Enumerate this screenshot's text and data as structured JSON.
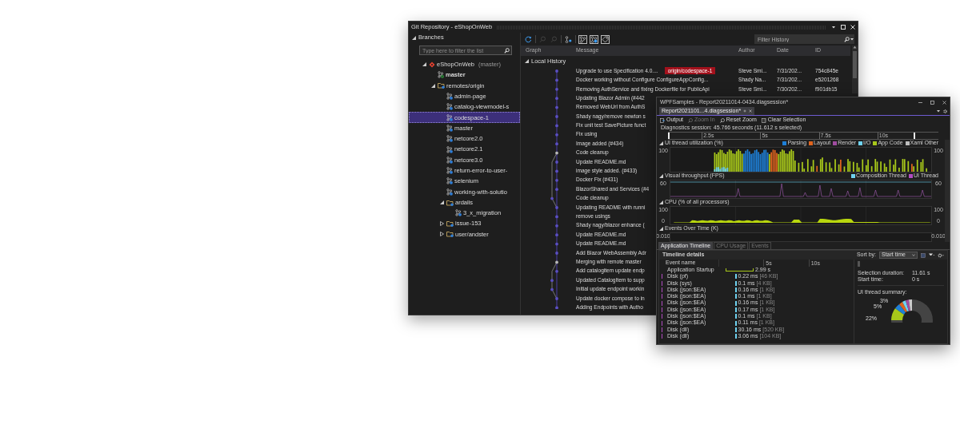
{
  "git_window": {
    "title": "Git Repository - eShopOnWeb",
    "branches": {
      "header": "Branches",
      "expanded": true,
      "filter": {
        "placeholder": "Type here to filter the list"
      },
      "tree": [
        {
          "label": "eShopOnWeb",
          "suffix": "(master)",
          "kind": "repo",
          "expanded": true,
          "selected": false,
          "children": [
            {
              "label": "master",
              "kind": "current_branch",
              "selected": false
            },
            {
              "label": "remotes/origin",
              "kind": "remote_folder",
              "expanded": true,
              "selected": false,
              "children": [
                {
                  "label": "admin-page",
                  "kind": "remote_branch",
                  "selected": false
                },
                {
                  "label": "catalog-viewmodel-s",
                  "kind": "remote_branch",
                  "selected": false
                },
                {
                  "label": "codespace-1",
                  "kind": "remote_branch",
                  "selected": true
                },
                {
                  "label": "master",
                  "kind": "remote_branch",
                  "selected": false
                },
                {
                  "label": "netcore2.0",
                  "kind": "remote_branch",
                  "selected": false
                },
                {
                  "label": "netcore2.1",
                  "kind": "remote_branch",
                  "selected": false
                },
                {
                  "label": "netcore3.0",
                  "kind": "remote_branch",
                  "selected": false
                },
                {
                  "label": "return-error-to-user-",
                  "kind": "remote_branch",
                  "selected": false
                },
                {
                  "label": "selenium",
                  "kind": "remote_branch",
                  "selected": false
                },
                {
                  "label": "working-with-solutio",
                  "kind": "remote_branch",
                  "selected": false
                },
                {
                  "label": "ardalis",
                  "kind": "folder",
                  "expanded": true,
                  "selected": false,
                  "children": [
                    {
                      "label": "3_x_migration",
                      "kind": "remote_branch",
                      "selected": false
                    }
                  ]
                },
                {
                  "label": "issue-153",
                  "kind": "folder",
                  "expanded": false,
                  "selected": false
                },
                {
                  "label": "user/andster",
                  "kind": "folder",
                  "expanded": false,
                  "selected": false
                }
              ]
            }
          ]
        }
      ]
    },
    "history": {
      "toolbar": [
        {
          "kind": "refresh",
          "disabled": false,
          "selected": false
        },
        {
          "kind": "search_previous",
          "disabled": true,
          "selected": false
        },
        {
          "kind": "search_next",
          "disabled": true,
          "selected": false
        },
        {
          "kind": "branch",
          "disabled": false,
          "selected": false
        },
        {
          "kind": "local_branches",
          "disabled": false,
          "selected": true
        },
        {
          "kind": "remote_branches",
          "disabled": false,
          "selected": true
        },
        {
          "kind": "tags",
          "disabled": false,
          "selected": true
        }
      ],
      "filter": {
        "placeholder": "Filter History"
      },
      "columns": [
        "Graph",
        "Message",
        "Author",
        "Date",
        "ID"
      ],
      "group": {
        "label": "Local History",
        "expanded": true
      },
      "commits": [
        {
          "message": "Upgrade to use Specification 4.0....",
          "tag": "origin/codespace-1",
          "author": "Steve Smi...",
          "date": "7/31/202...",
          "id": "754c845e",
          "kind": "commit",
          "selected": false
        },
        {
          "message": "Docker working without Configure ConfigureAppConfig...",
          "author": "Shady Na...",
          "date": "7/31/202...",
          "id": "e5201268",
          "kind": "commit",
          "selected": false
        },
        {
          "message": "Removing AuthService and fixing Dockerfile for PublicApi",
          "author": "Steve Smi...",
          "date": "7/30/202...",
          "id": "f901db15",
          "kind": "commit",
          "selected": false
        },
        {
          "message": "Updating Blazor Admin (#442",
          "kind": "commit",
          "selected": false
        },
        {
          "message": "Removed WebUrl from AuthS",
          "kind": "commit",
          "selected": false
        },
        {
          "message": "Shady nagy/remove newton s",
          "kind": "commit",
          "selected": false
        },
        {
          "message": "Fix unit test SavePicture funct",
          "kind": "commit",
          "selected": false
        },
        {
          "message": "Fix using",
          "kind": "commit",
          "selected": false
        },
        {
          "message": "Image added (#434)",
          "kind": "commit",
          "selected": false
        },
        {
          "message": "Code cleanup",
          "kind": "merge",
          "selected": false
        },
        {
          "message": "Update README.md",
          "kind": "commit",
          "selected": false
        },
        {
          "message": "image style added. (#433)",
          "kind": "commit",
          "selected": false
        },
        {
          "message": "Docker Fix (#431)",
          "kind": "commit",
          "selected": false
        },
        {
          "message": "BlazorShared and Services (#4",
          "kind": "commit",
          "selected": false
        },
        {
          "message": "Code cleanup",
          "kind": "side",
          "selected": false
        },
        {
          "message": "Updating README with runni",
          "kind": "commit",
          "selected": false
        },
        {
          "message": "remove usings",
          "kind": "commit",
          "selected": false
        },
        {
          "message": "Shady nagy/blazor enhance (",
          "kind": "commit",
          "selected": false
        },
        {
          "message": "Update README.md",
          "kind": "commit",
          "selected": false
        },
        {
          "message": "Update README.md",
          "kind": "commit",
          "selected": false
        },
        {
          "message": "Add Blazor WebAssembly Adr",
          "kind": "commit",
          "selected": false
        },
        {
          "message": "Merging with remote master",
          "kind": "merge",
          "selected": false
        },
        {
          "message": "Add catalogitem update endp",
          "kind": "commit",
          "selected": false
        },
        {
          "message": "Updated CatalogItem to supp",
          "kind": "side",
          "selected": false
        },
        {
          "message": "Initial update endpoint workin",
          "kind": "side",
          "selected": false
        },
        {
          "message": "Update docker compose to in",
          "kind": "commit",
          "selected": false
        },
        {
          "message": "Adding Endpoints with Autho",
          "kind": "commit",
          "selected": false
        }
      ]
    }
  },
  "diag_window": {
    "title": "WPFSamples - Report20211014-0434.diagsession*",
    "tabs": [
      {
        "label": "Report2021101...4.diagsession*",
        "selected": true
      }
    ],
    "toolbar": [
      {
        "label": "Output",
        "kind": "output",
        "disabled": false
      },
      {
        "label": "Zoom In",
        "kind": "zoom_in",
        "disabled": true
      },
      {
        "label": "Reset Zoom",
        "kind": "reset_zoom",
        "disabled": false
      },
      {
        "label": "Clear Selection",
        "kind": "clear_selection",
        "disabled": false
      }
    ],
    "session": "Diagnostics session: 45.766 seconds (11.612 s selected)",
    "ruler": [
      "2.5s",
      "5s",
      "7.5s",
      "10s"
    ],
    "graphs": [
      {
        "title": "UI thread utilization (%)",
        "kind": "utilization",
        "expanded": true,
        "left_labels": [
          "100"
        ],
        "right_labels": [
          "100"
        ],
        "legend": [
          {
            "label": "Parsing",
            "color": "#1e7fd6"
          },
          {
            "label": "Layout",
            "color": "#e0641e"
          },
          {
            "label": "Render",
            "color": "#a04ca0"
          },
          {
            "label": "I/O",
            "color": "#6fd2f0"
          },
          {
            "label": "App Code",
            "color": "#a8c81a"
          },
          {
            "label": "Xaml Other",
            "color": "#bdbdbd"
          }
        ]
      },
      {
        "title": "Visual throughput (FPS)",
        "kind": "throughput",
        "expanded": true,
        "left_labels": [
          "60"
        ],
        "right_labels": [
          "60"
        ],
        "legend": [
          {
            "label": "Composition Thread",
            "color": "#6fd2f0"
          },
          {
            "label": "UI Thread",
            "color": "#b04cc0"
          }
        ]
      },
      {
        "title": "CPU (% of all processors)",
        "kind": "cpu",
        "expanded": true,
        "left_labels": [
          "100",
          "0"
        ],
        "right_labels": [
          "100",
          "0"
        ]
      },
      {
        "title": "Events Over Time (K)",
        "kind": "events",
        "expanded": true,
        "left_labels": [
          "0.010"
        ],
        "right_labels": [
          "0.010"
        ]
      }
    ],
    "bottom_tabs": [
      {
        "label": "Application Timeline",
        "selected": true
      },
      {
        "label": "CPU Usage",
        "selected": false
      },
      {
        "label": "Events",
        "selected": false
      }
    ],
    "details": {
      "title": "Timeline details",
      "sort_label": "Sort by:",
      "sort_value": "Start time",
      "column": "Event name",
      "ruler": [
        "5s",
        "10s"
      ],
      "events": [
        {
          "name": "Application Startup",
          "kind": "startup",
          "duration": "2.99 s"
        },
        {
          "name": "Disk (pf)",
          "kind": "disk",
          "duration": "0.22 ms",
          "size": "[46 KB]"
        },
        {
          "name": "Disk (sys)",
          "kind": "disk",
          "duration": "0.1 ms",
          "size": "[4 KB]"
        },
        {
          "name": "Disk (json:$EA)",
          "kind": "disk",
          "duration": "0.16 ms",
          "size": "[1 KB]"
        },
        {
          "name": "Disk (json:$EA)",
          "kind": "disk",
          "duration": "0.1 ms",
          "size": "[1 KB]"
        },
        {
          "name": "Disk (json:$EA)",
          "kind": "disk",
          "duration": "0.16 ms",
          "size": "[1 KB]"
        },
        {
          "name": "Disk (json:$EA)",
          "kind": "disk",
          "duration": "0.17 ms",
          "size": "[1 KB]"
        },
        {
          "name": "Disk (json:$EA)",
          "kind": "disk",
          "duration": "0.1 ms",
          "size": "[1 KB]"
        },
        {
          "name": "Disk (json:$EA)",
          "kind": "disk",
          "duration": "0.11 ms",
          "size": "[1 KB]"
        },
        {
          "name": "Disk (dll)",
          "kind": "disk",
          "duration": "30.16 ms",
          "size": "[520 KB]"
        },
        {
          "name": "Disk (dll)",
          "kind": "disk",
          "duration": "3.06 ms",
          "size": "[104 KB]"
        }
      ],
      "summary": {
        "duration_label": "Selection duration:",
        "duration": "11.61 s",
        "start_label": "Start time:",
        "start": "0 s",
        "title": "UI thread summary:",
        "donut_labels": [
          "3%",
          "5%",
          "22%"
        ]
      }
    }
  }
}
